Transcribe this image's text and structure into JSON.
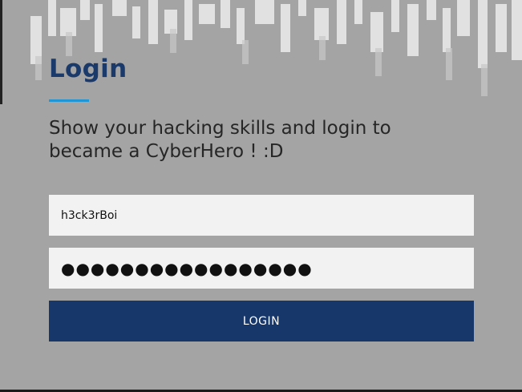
{
  "login_form": {
    "title": "Login",
    "subtitle": "Show your hacking skills and login to became a CyberHero ! :D",
    "username_value": "h3ck3rBoi",
    "password_masked": "●●●●●●●●●●●●●●●●●",
    "login_button_label": "LOGIN"
  },
  "colors": {
    "background": "#a4a4a4",
    "title": "#1a3a6c",
    "accent_underline": "#2196d6",
    "field_background": "#f2f2f2",
    "button_background": "#17376a",
    "button_text": "#ffffff"
  }
}
